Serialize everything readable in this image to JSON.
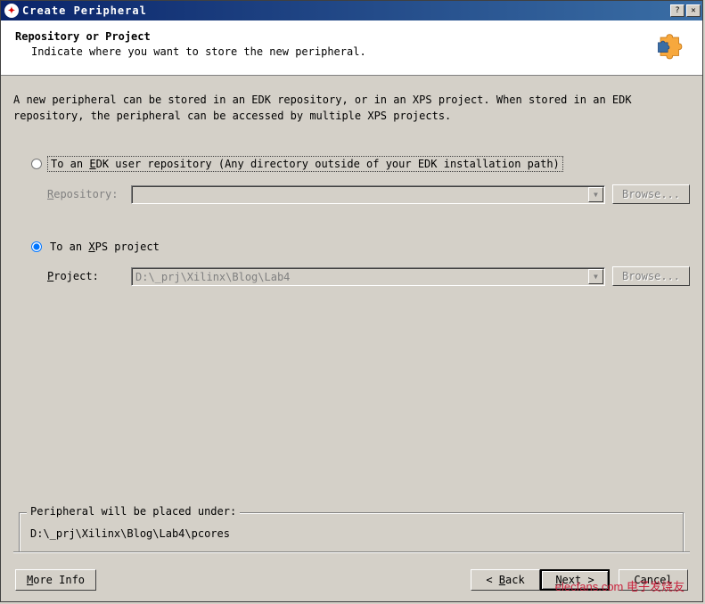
{
  "title": "Create Peripheral",
  "header": {
    "title": "Repository or Project",
    "subtitle": "Indicate where you want to store the new peripheral."
  },
  "description": "A new peripheral can be stored in an EDK repository, or in an XPS project. When stored in an EDK repository, the peripheral can be accessed by multiple XPS projects.",
  "options": {
    "edk": {
      "label": "To an EDK user repository (Any directory outside of your EDK installation path)",
      "field_label": "Repository:",
      "browse": "Browse..."
    },
    "xps": {
      "label": "To an XPS project",
      "field_label": "Project:",
      "value": "D:\\_prj\\Xilinx\\Blog\\Lab4",
      "browse": "Browse..."
    }
  },
  "groupbox": {
    "title": "Peripheral will be placed under:",
    "path": "D:\\_prj\\Xilinx\\Blog\\Lab4\\pcores"
  },
  "buttons": {
    "more_info": "More Info",
    "back": "< Back",
    "next": "Next >",
    "cancel": "Cancel"
  },
  "titlebar_buttons": {
    "help": "?",
    "close": "✕"
  },
  "watermark": "elecfans.com  电子发烧友"
}
